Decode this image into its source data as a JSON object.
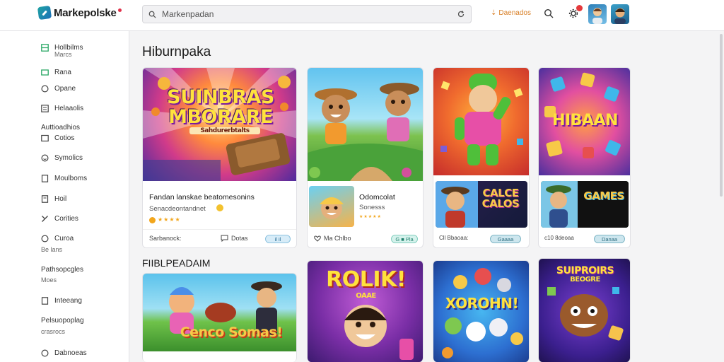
{
  "app": {
    "name": "Markepolske",
    "search_placeholder": "Markenpadan",
    "top_action": "Daenados"
  },
  "sidebar": {
    "items": [
      {
        "label": "Hollbilms",
        "sub": "Marcs"
      },
      {
        "label": "Rana"
      },
      {
        "label": "Opane"
      },
      {
        "label": "Helaaolis"
      },
      {
        "heading": "Auttioadhios",
        "label": "Cotios"
      },
      {
        "label": "Symolics"
      },
      {
        "label": "Moulboms"
      },
      {
        "label": "Hoil"
      },
      {
        "label": "Corities"
      },
      {
        "label": "Curoa",
        "sub": "Be lans"
      },
      {
        "heading": "Pathsopcgles",
        "sub": "Moes"
      },
      {
        "label": "Inteeang"
      },
      {
        "heading": "Pelsuopoplag",
        "sub": "crasrocs"
      },
      {
        "label": "Dabnoeas"
      }
    ]
  },
  "sections": [
    {
      "title": "Hiburnpaka"
    },
    {
      "title": "FIIBLPEADAIM"
    }
  ],
  "featured": {
    "art_title": "SUINBRAS MBORARE",
    "art_sub": "Sahdurerbtalts",
    "title": "Fandan lanskae beatomesonins",
    "subtitle": "Senacdeontandnet",
    "stars": "★★★★",
    "footer_left": "Sarbanock:",
    "footer_mid": "Dotas",
    "pill": "il il"
  },
  "card2": {
    "title": "Odomcolat",
    "subtitle": "Sonesss",
    "stars": "★★★★★",
    "footer_left": "Ma Chlbo",
    "pill": "G ■ Pla"
  },
  "card3": {
    "tile_text": "CALCE CALOS",
    "footer_left": "Cll Bbaoaa:",
    "pill": "Gaaaa"
  },
  "card4": {
    "art_title": "HIBAAN",
    "tile_text": "GAMES",
    "footer_left": "c10 8deoaa",
    "pill": "Danaa"
  },
  "row2": [
    {
      "art_title": "Cenco Somas!"
    },
    {
      "art_title": "ROLIK!",
      "art_sub": "OAAE"
    },
    {
      "art_title": "XOROHN!"
    },
    {
      "art_title": "SUIPROIRS",
      "art_sub": "BEOGRE"
    }
  ],
  "colors": {
    "accent": "#d9822b",
    "pill_blue": "#d7ecf8",
    "pill_green": "#d5f2ec",
    "badge": "#e5393b",
    "star": "#f2a61c"
  }
}
